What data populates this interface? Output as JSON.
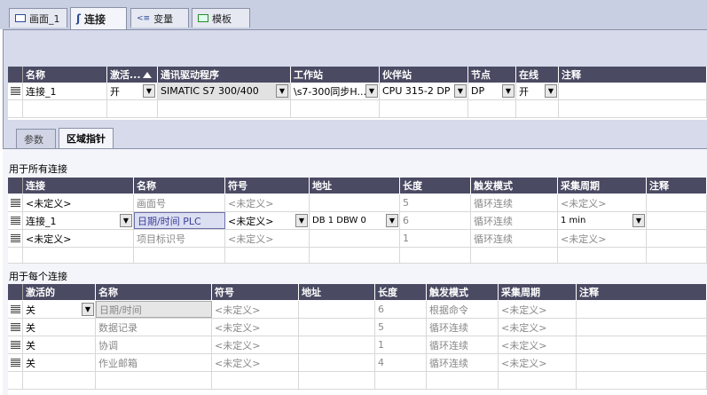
{
  "tabs": [
    {
      "label": "画面_1",
      "icon": "screen-icon"
    },
    {
      "label": "连接",
      "icon": "connection-icon"
    },
    {
      "label": "变量",
      "icon": "tags-icon"
    },
    {
      "label": "模板",
      "icon": "template-icon"
    }
  ],
  "connections": {
    "headers": [
      "名称",
      "激活...",
      "通讯驱动程序",
      "工作站",
      "伙伴站",
      "节点",
      "在线",
      "注释"
    ],
    "row": {
      "name": "连接_1",
      "active": "开",
      "driver": "SIMATIC S7 300/400",
      "station": "\\s7-300同步H...",
      "partner": "CPU 315-2 DP",
      "node": "DP",
      "online": "开",
      "comment": ""
    }
  },
  "subtabs": [
    "参数",
    "区域指针"
  ],
  "all_section": {
    "title": "用于所有连接",
    "headers": [
      "连接",
      "名称",
      "符号",
      "地址",
      "长度",
      "触发模式",
      "采集周期",
      "注释"
    ],
    "rows": [
      {
        "conn": "<未定义>",
        "name": "画面号",
        "symbol": "<未定义>",
        "addr": "",
        "len": "5",
        "trigger": "循环连续",
        "cycle": "<未定义>"
      },
      {
        "conn": "连接_1",
        "name": "日期/时间 PLC",
        "symbol": "<未定义>",
        "addr": "DB 1 DBW 0",
        "len": "6",
        "trigger": "循环连续",
        "cycle": "1 min"
      },
      {
        "conn": "<未定义>",
        "name": "项目标识号",
        "symbol": "<未定义>",
        "addr": "",
        "len": "1",
        "trigger": "循环连续",
        "cycle": "<未定义>"
      }
    ]
  },
  "each_section": {
    "title": "用于每个连接",
    "headers": [
      "激活的",
      "名称",
      "符号",
      "地址",
      "长度",
      "触发模式",
      "采集周期",
      "注释"
    ],
    "rows": [
      {
        "active": "关",
        "name": "日期/时间",
        "symbol": "<未定义>",
        "addr": "",
        "len": "6",
        "trigger": "根据命令",
        "cycle": "<未定义>"
      },
      {
        "active": "关",
        "name": "数据记录",
        "symbol": "<未定义>",
        "addr": "",
        "len": "5",
        "trigger": "循环连续",
        "cycle": "<未定义>"
      },
      {
        "active": "关",
        "name": "协调",
        "symbol": "<未定义>",
        "addr": "",
        "len": "1",
        "trigger": "循环连续",
        "cycle": "<未定义>"
      },
      {
        "active": "关",
        "name": "作业邮箱",
        "symbol": "<未定义>",
        "addr": "",
        "len": "4",
        "trigger": "循环连续",
        "cycle": "<未定义>"
      }
    ]
  }
}
